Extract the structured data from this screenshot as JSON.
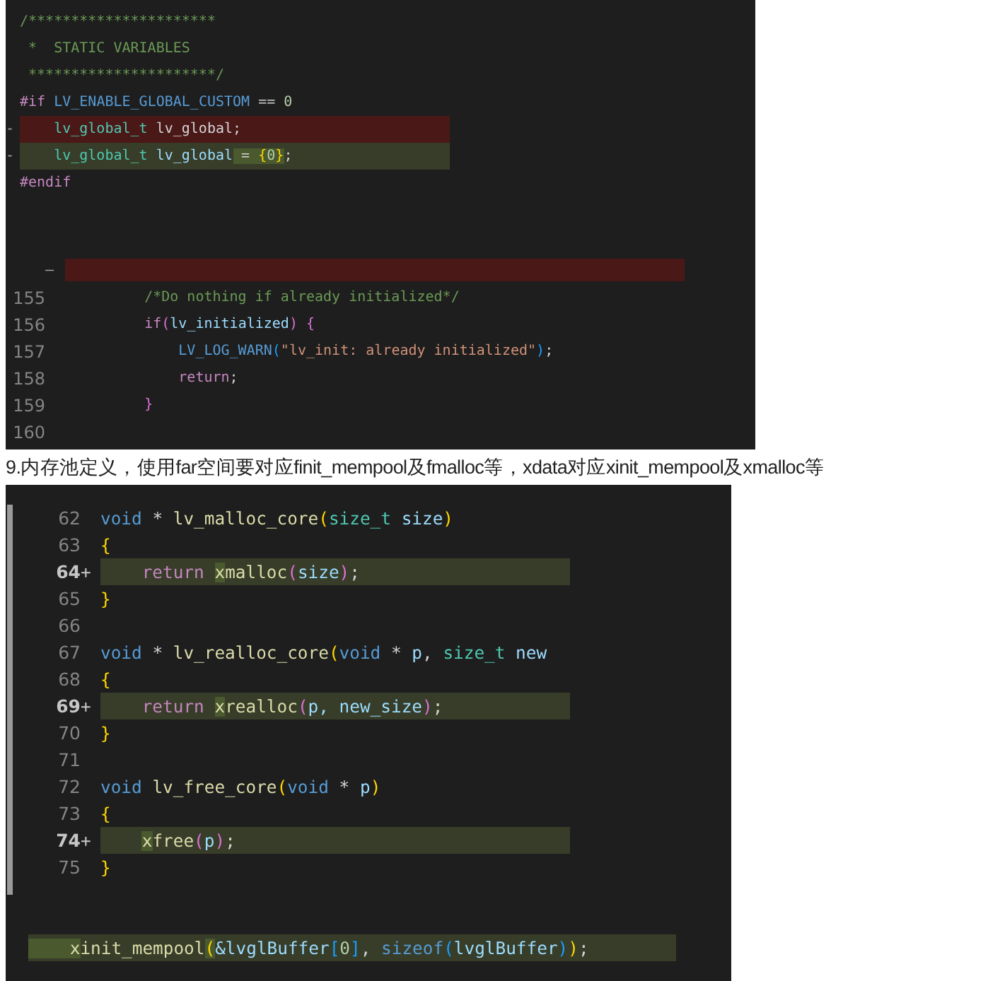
{
  "blocks": [
    {
      "kind": "code",
      "sections": [
        {
          "gutter": false,
          "lines": [
            {
              "added": false,
              "removed": false,
              "tokens": [
                {
                  "text": "/**********************",
                  "kind": "comment"
                }
              ]
            },
            {
              "added": false,
              "removed": false,
              "tokens": [
                {
                  "text": " *  STATIC VARIABLES",
                  "kind": "comment"
                }
              ]
            },
            {
              "added": false,
              "removed": false,
              "tokens": [
                {
                  "text": " **********************/",
                  "kind": "comment"
                }
              ]
            },
            {
              "added": false,
              "removed": false,
              "tokens": [
                {
                  "text": "#if ",
                  "kind": "keyword"
                },
                {
                  "text": "LV_ENABLE_GLOBAL_CUSTOM",
                  "kind": "macro"
                },
                {
                  "text": " == ",
                  "kind": "plain"
                },
                {
                  "text": "0",
                  "kind": "number"
                }
              ]
            },
            {
              "added": false,
              "removed": true,
              "marker": "-",
              "tokens": [
                {
                  "text": "    lv_global_t",
                  "kind": "type"
                },
                {
                  "text": " lv_global;",
                  "kind": "plain"
                }
              ]
            },
            {
              "added": true,
              "removed": false,
              "marker": "-",
              "tokens": [
                {
                  "text": "    lv_global_t",
                  "kind": "type"
                },
                {
                  "text": " lv_global",
                  "kind": "var"
                },
                {
                  "text": " = ",
                  "kind": "plain",
                  "highlight": true
                },
                {
                  "text": "{",
                  "kind": "bracket1",
                  "highlight": true
                },
                {
                  "text": "0",
                  "kind": "number",
                  "highlight": true
                },
                {
                  "text": "}",
                  "kind": "bracket1",
                  "highlight": true
                },
                {
                  "text": ";",
                  "kind": "plain"
                }
              ]
            },
            {
              "added": false,
              "removed": false,
              "tokens": [
                {
                  "text": "#endif",
                  "kind": "keyword"
                }
              ]
            }
          ]
        },
        {
          "gutter": true,
          "lines": [
            {
              "added": false,
              "removed": true,
              "marker": "—"
            },
            {
              "added": false,
              "removed": false,
              "number": "155",
              "tokens": [
                {
                  "text": "    /*Do nothing if already initialized*/",
                  "kind": "comment"
                }
              ]
            },
            {
              "added": false,
              "removed": false,
              "number": "156",
              "tokens": [
                {
                  "text": "    if",
                  "kind": "keyword"
                },
                {
                  "text": "(",
                  "kind": "bracket2"
                },
                {
                  "text": "lv_initialized",
                  "kind": "var"
                },
                {
                  "text": ")",
                  "kind": "bracket2"
                },
                {
                  "text": " {",
                  "kind": "bracket2"
                }
              ]
            },
            {
              "added": false,
              "removed": false,
              "number": "157",
              "tokens": [
                {
                  "text": "        LV_LOG_WARN",
                  "kind": "macro"
                },
                {
                  "text": "(",
                  "kind": "bracket3"
                },
                {
                  "text": "\"lv_init: already initialized\"",
                  "kind": "string"
                },
                {
                  "text": ")",
                  "kind": "bracket3"
                },
                {
                  "text": ";",
                  "kind": "plain"
                }
              ]
            },
            {
              "added": false,
              "removed": false,
              "number": "158",
              "tokens": [
                {
                  "text": "        return",
                  "kind": "keyword"
                },
                {
                  "text": ";",
                  "kind": "plain"
                }
              ]
            },
            {
              "added": false,
              "removed": false,
              "number": "159",
              "tokens": [
                {
                  "text": "    }",
                  "kind": "bracket2"
                }
              ]
            },
            {
              "added": false,
              "removed": false,
              "number": "160"
            }
          ]
        }
      ]
    },
    {
      "kind": "caption",
      "text": "9.内存池定义，使用far空间要对应finit_mempool及fmalloc等，xdata对应xinit_mempool及xmalloc等"
    },
    {
      "kind": "code",
      "sections": [
        {
          "gutter": true,
          "lines": [
            {
              "added": false,
              "removed": false,
              "number": "62",
              "tokens": [
                {
                  "text": "void",
                  "kind": "macro"
                },
                {
                  "text": " * ",
                  "kind": "plain"
                },
                {
                  "text": "lv_malloc_core",
                  "kind": "fn"
                },
                {
                  "text": "(",
                  "kind": "bracket1"
                },
                {
                  "text": "size_t",
                  "kind": "type"
                },
                {
                  "text": " size",
                  "kind": "var"
                },
                {
                  "text": ")",
                  "kind": "bracket1"
                }
              ]
            },
            {
              "added": false,
              "removed": false,
              "number": "63",
              "tokens": [
                {
                  "text": "{",
                  "kind": "bracket1"
                }
              ]
            },
            {
              "added": true,
              "removed": false,
              "marker": "+",
              "number": "64",
              "tokens": [
                {
                  "text": "    return ",
                  "kind": "keyword"
                },
                {
                  "text": "x",
                  "kind": "fn",
                  "highlight": true
                },
                {
                  "text": "malloc",
                  "kind": "fn"
                },
                {
                  "text": "(",
                  "kind": "bracket2"
                },
                {
                  "text": "size",
                  "kind": "var"
                },
                {
                  "text": ")",
                  "kind": "bracket2"
                },
                {
                  "text": ";",
                  "kind": "plain"
                }
              ]
            },
            {
              "added": false,
              "removed": false,
              "number": "65",
              "tokens": [
                {
                  "text": "}",
                  "kind": "bracket1"
                }
              ]
            },
            {
              "added": false,
              "removed": false,
              "number": "66"
            },
            {
              "added": false,
              "removed": false,
              "number": "67",
              "tokens": [
                {
                  "text": "void",
                  "kind": "macro"
                },
                {
                  "text": " * ",
                  "kind": "plain"
                },
                {
                  "text": "lv_realloc_core",
                  "kind": "fn"
                },
                {
                  "text": "(",
                  "kind": "bracket1"
                },
                {
                  "text": "void",
                  "kind": "macro"
                },
                {
                  "text": " * ",
                  "kind": "plain"
                },
                {
                  "text": "p",
                  "kind": "var"
                },
                {
                  "text": ", ",
                  "kind": "plain"
                },
                {
                  "text": "size_t",
                  "kind": "type"
                },
                {
                  "text": " new",
                  "kind": "var"
                }
              ]
            },
            {
              "added": false,
              "removed": false,
              "number": "68",
              "tokens": [
                {
                  "text": "{",
                  "kind": "bracket1"
                }
              ]
            },
            {
              "added": true,
              "removed": false,
              "marker": "+",
              "number": "69",
              "tokens": [
                {
                  "text": "    return ",
                  "kind": "keyword"
                },
                {
                  "text": "x",
                  "kind": "fn",
                  "highlight": true
                },
                {
                  "text": "realloc",
                  "kind": "fn"
                },
                {
                  "text": "(",
                  "kind": "bracket2"
                },
                {
                  "text": "p, new_size",
                  "kind": "var"
                },
                {
                  "text": ")",
                  "kind": "bracket2"
                },
                {
                  "text": ";",
                  "kind": "plain"
                }
              ]
            },
            {
              "added": false,
              "removed": false,
              "number": "70",
              "tokens": [
                {
                  "text": "}",
                  "kind": "bracket1"
                }
              ]
            },
            {
              "added": false,
              "removed": false,
              "number": "71"
            },
            {
              "added": false,
              "removed": false,
              "number": "72",
              "tokens": [
                {
                  "text": "void",
                  "kind": "macro"
                },
                {
                  "text": " lv_free_core",
                  "kind": "fn"
                },
                {
                  "text": "(",
                  "kind": "bracket1"
                },
                {
                  "text": "void",
                  "kind": "macro"
                },
                {
                  "text": " * ",
                  "kind": "plain"
                },
                {
                  "text": "p",
                  "kind": "var"
                },
                {
                  "text": ")",
                  "kind": "bracket1"
                }
              ]
            },
            {
              "added": false,
              "removed": false,
              "number": "73",
              "tokens": [
                {
                  "text": "{",
                  "kind": "bracket1"
                }
              ]
            },
            {
              "added": true,
              "removed": false,
              "indented": true,
              "marker": "+",
              "number": "74",
              "tokens": [
                {
                  "text": "x",
                  "kind": "fn",
                  "highlight": true
                },
                {
                  "text": "free",
                  "kind": "fn"
                },
                {
                  "text": "(",
                  "kind": "bracket2"
                },
                {
                  "text": "p",
                  "kind": "var"
                },
                {
                  "text": ")",
                  "kind": "bracket2"
                },
                {
                  "text": ";",
                  "kind": "plain"
                }
              ]
            },
            {
              "added": false,
              "removed": false,
              "number": "75",
              "tokens": [
                {
                  "text": "}",
                  "kind": "bracket1"
                }
              ]
            }
          ]
        },
        {
          "gutter": false,
          "lines": [
            {
              "added": true,
              "removed": false,
              "tokens": [
                {
                  "text": "    x",
                  "kind": "fn",
                  "highlight": true
                },
                {
                  "text": "init_mempool",
                  "kind": "fn"
                },
                {
                  "text": "(",
                  "kind": "bracket1",
                  "highlight": true
                },
                {
                  "text": "&lvglBuffer",
                  "kind": "var"
                },
                {
                  "text": "[",
                  "kind": "bracket3"
                },
                {
                  "text": "0",
                  "kind": "number"
                },
                {
                  "text": "]",
                  "kind": "bracket3"
                },
                {
                  "text": ", ",
                  "kind": "plain"
                },
                {
                  "text": "sizeof",
                  "kind": "macro"
                },
                {
                  "text": "(",
                  "kind": "bracket3"
                },
                {
                  "text": "lvglBuffer",
                  "kind": "var"
                },
                {
                  "text": ")",
                  "kind": "bracket3"
                },
                {
                  "text": ")",
                  "kind": "bracket1"
                },
                {
                  "text": ";",
                  "kind": "plain"
                }
              ]
            }
          ]
        }
      ]
    }
  ]
}
